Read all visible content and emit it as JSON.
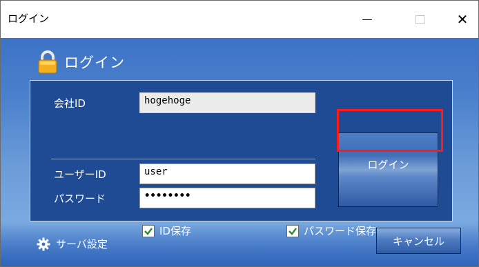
{
  "window": {
    "title": "ログイン",
    "controls": {
      "minimize": "—",
      "maximize": "□",
      "close": "✕"
    }
  },
  "heading": {
    "icon": "lock-icon",
    "text": "ログイン"
  },
  "form": {
    "company_id": {
      "label": "会社ID",
      "value": "hogehoge"
    },
    "user_id": {
      "label": "ユーザーID",
      "value": "user"
    },
    "password": {
      "label": "パスワード",
      "value": "••••••••"
    },
    "save_id": {
      "label": "ID保存",
      "checked": true
    },
    "save_password": {
      "label": "パスワード保存",
      "checked": true
    }
  },
  "buttons": {
    "login": "ログイン",
    "cancel": "キャンセル"
  },
  "server_settings": {
    "icon": "gear-icon",
    "label": "サーバ設定"
  },
  "colors": {
    "panel": "#1f4b95",
    "accent": "#3d73c4",
    "highlight": "#ff1a1a"
  }
}
